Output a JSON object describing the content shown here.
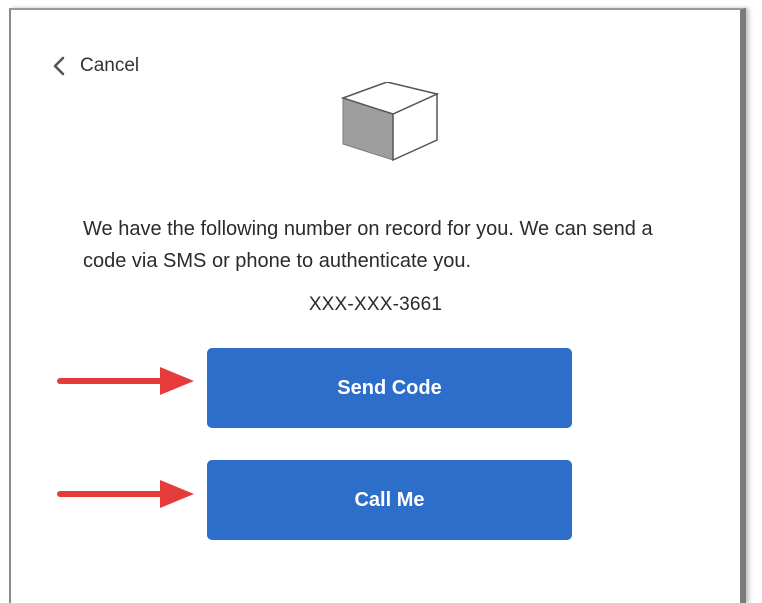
{
  "cancel": {
    "label": "Cancel",
    "icon": "chevron-left-icon"
  },
  "illustration": {
    "icon": "cube-icon"
  },
  "message": "We have the following number on record for you. We can send a code via SMS or phone to authenticate you.",
  "phone_number": "XXX-XXX-3661",
  "buttons": {
    "send_code": "Send Code",
    "call_me": "Call Me"
  },
  "annotations": {
    "arrow_color": "#e63b3b"
  },
  "colors": {
    "button_bg": "#2c6ec9",
    "button_text": "#ffffff",
    "text": "#2b2b2b"
  }
}
